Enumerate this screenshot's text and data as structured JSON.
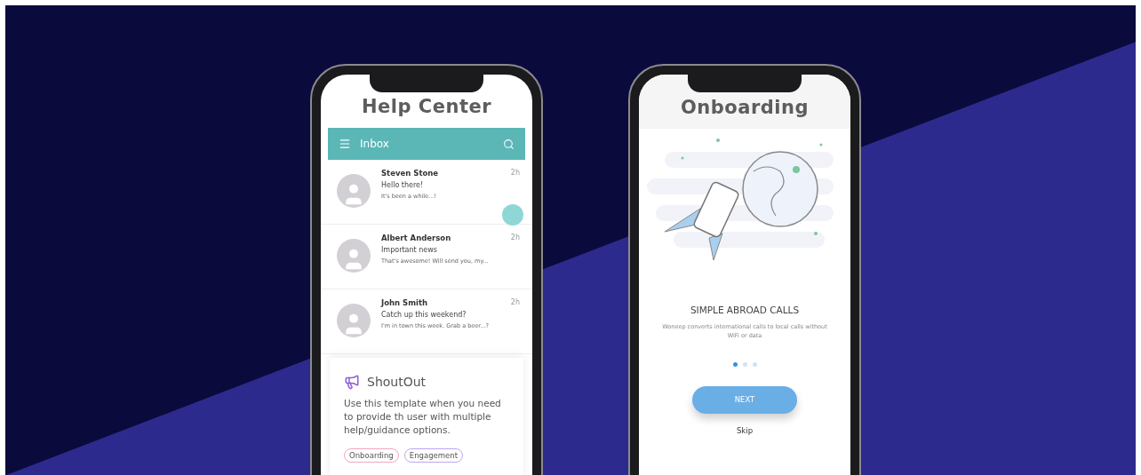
{
  "help_center": {
    "title": "Help Center",
    "toolbar": {
      "title": "Inbox"
    },
    "messages": [
      {
        "sender": "Steven Stone",
        "subject": "Hello there!",
        "preview": "It's been a while...!",
        "time": "2h"
      },
      {
        "sender": "Albert Anderson",
        "subject": "Important news",
        "preview": "That's awesome! Will send you, my...",
        "time": "2h"
      },
      {
        "sender": "John Smith",
        "subject": "Catch up this weekend?",
        "preview": "I'm in town this week. Grab a beer...?",
        "time": "2h"
      }
    ],
    "shoutout": {
      "title": "ShoutOut",
      "description": "Use this template when you need to provide th user with multiple help/guidance options.",
      "tags": [
        {
          "label": "Onboarding",
          "color": "#f2a6bd"
        },
        {
          "label": "Engagement",
          "color": "#bda6f2"
        }
      ]
    }
  },
  "onboarding": {
    "title": "Onboarding",
    "heading": "SIMPLE ABROAD CALLS",
    "description": "Woneep converts international calls to local calls without WiFi or data",
    "pager": [
      {
        "selected": true
      },
      {
        "selected": false
      },
      {
        "selected": false
      }
    ],
    "next_button": "NEXT",
    "skip": "Skip"
  }
}
